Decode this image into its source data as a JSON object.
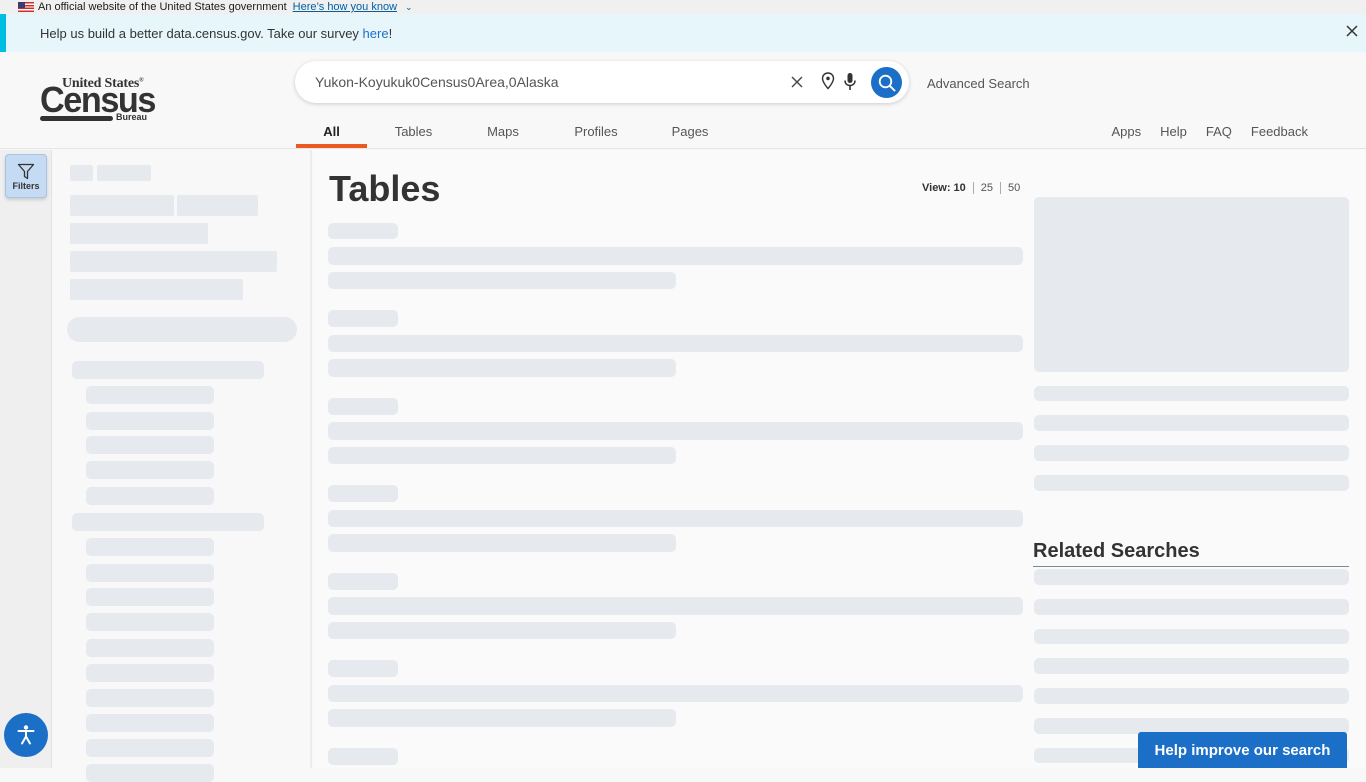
{
  "gov_banner": {
    "text": "An official website of the United States government",
    "link": "Here’s how you know"
  },
  "survey_banner": {
    "text": "Help us build a better data.census.gov. Take our survey ",
    "link": "here",
    "suffix": "!",
    "accent_color": "#00bde3"
  },
  "logo": {
    "top": "United States",
    "main": "Census",
    "bottom": "Bureau"
  },
  "search": {
    "value": "Yukon-Koyukuk0Census0Area,0Alaska",
    "advanced_label": "Advanced Search"
  },
  "tabs": [
    {
      "label": "All",
      "active": true
    },
    {
      "label": "Tables",
      "active": false
    },
    {
      "label": "Maps",
      "active": false
    },
    {
      "label": "Profiles",
      "active": false
    },
    {
      "label": "Pages",
      "active": false
    }
  ],
  "utility_links": [
    "Apps",
    "Help",
    "FAQ",
    "Feedback"
  ],
  "rail": {
    "filters_label": "Filters"
  },
  "main": {
    "title": "Tables",
    "view": {
      "label": "View:",
      "options": [
        "10",
        "25",
        "50"
      ],
      "selected": "10"
    },
    "related_title": "Related Searches"
  },
  "help_button": "Help improve our search",
  "colors": {
    "brand_blue": "#1c6fc7",
    "active_tab": "#ec5a24",
    "skeleton": "#e6e9ed"
  }
}
